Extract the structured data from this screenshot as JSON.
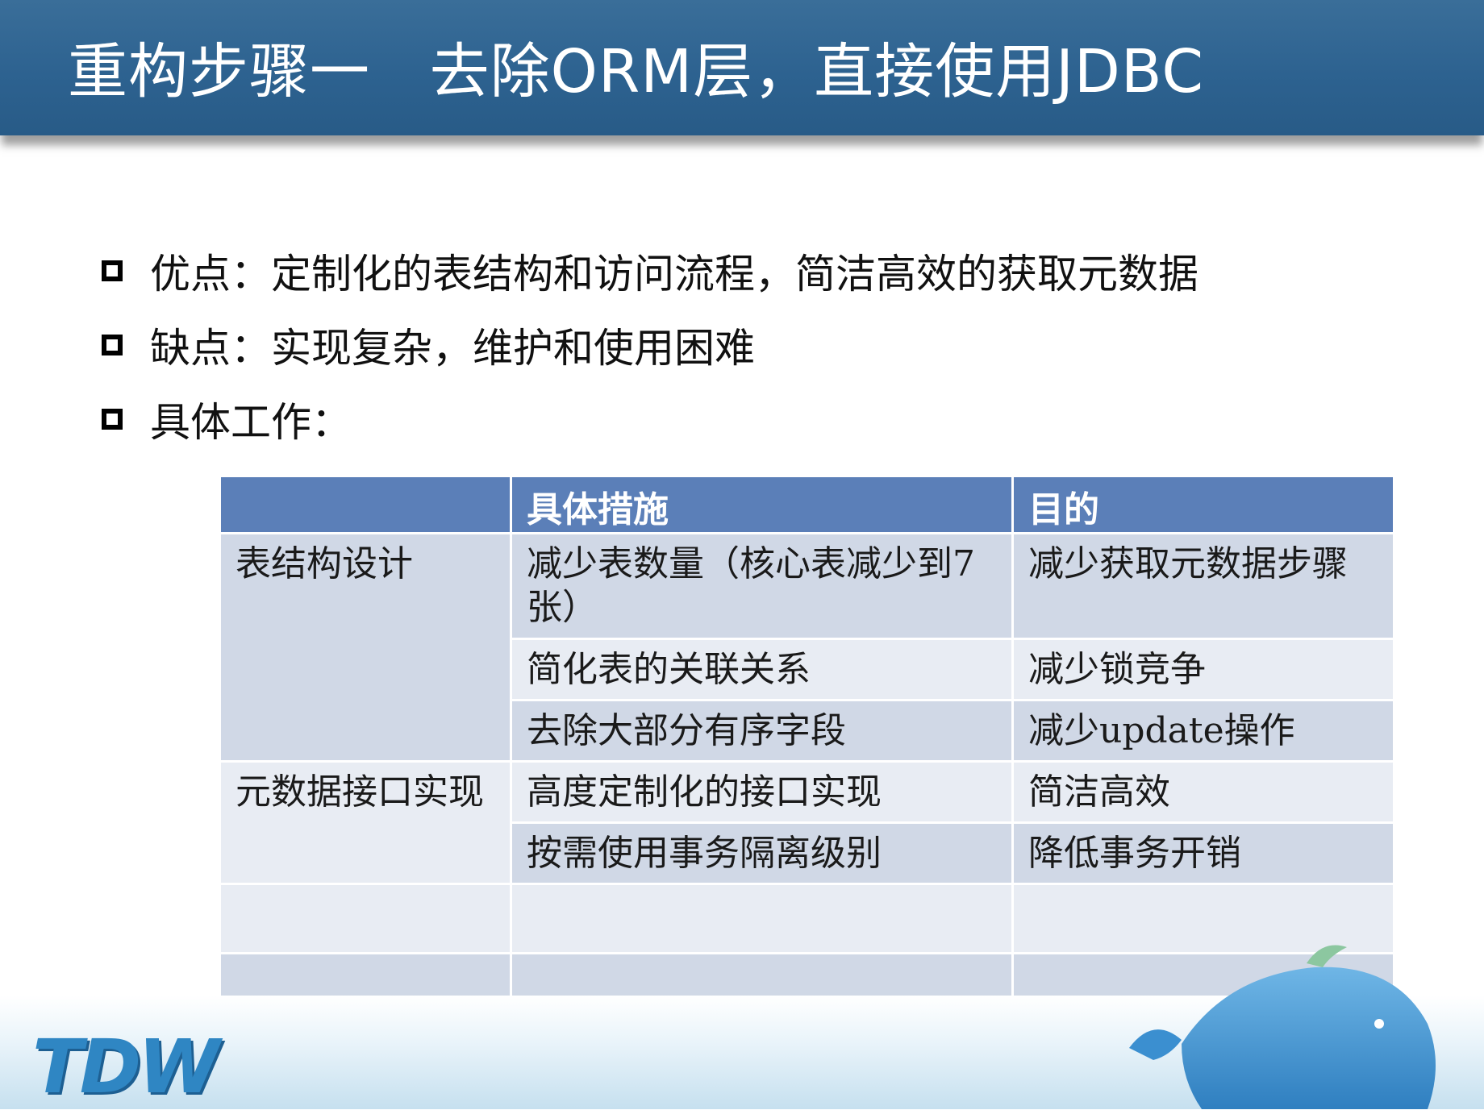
{
  "header": {
    "title": "重构步骤一   去除ORM层，直接使用JDBC"
  },
  "bullets": [
    {
      "text": "优点：定制化的表结构和访问流程，简洁高效的获取元数据"
    },
    {
      "text": "缺点：实现复杂，维护和使用困难"
    },
    {
      "text": "具体工作："
    }
  ],
  "table": {
    "headers": [
      "",
      "具体措施",
      "目的"
    ],
    "groups": [
      {
        "label": "表结构设计",
        "rows": [
          {
            "measure": "减少表数量（核心表减少到7张）",
            "purpose": "减少获取元数据步骤"
          },
          {
            "measure": "简化表的关联关系",
            "purpose": "减少锁竞争"
          },
          {
            "measure": "去除大部分有序字段",
            "purpose": "减少update操作"
          }
        ]
      },
      {
        "label": "元数据接口实现",
        "rows": [
          {
            "measure": "高度定制化的接口实现",
            "purpose": "简洁高效"
          },
          {
            "measure": "按需使用事务隔离级别",
            "purpose": "降低事务开销"
          }
        ]
      }
    ]
  },
  "footer": {
    "logo_text": "TDW",
    "colors": {
      "logo": "#2f86c3",
      "whale": "#3b8fd0"
    }
  },
  "colors": {
    "header_bg": "#2d6290",
    "table_header_bg": "#5b7fb8",
    "table_row_dark": "#d0d8e6",
    "table_row_light": "#e8ecf3"
  }
}
